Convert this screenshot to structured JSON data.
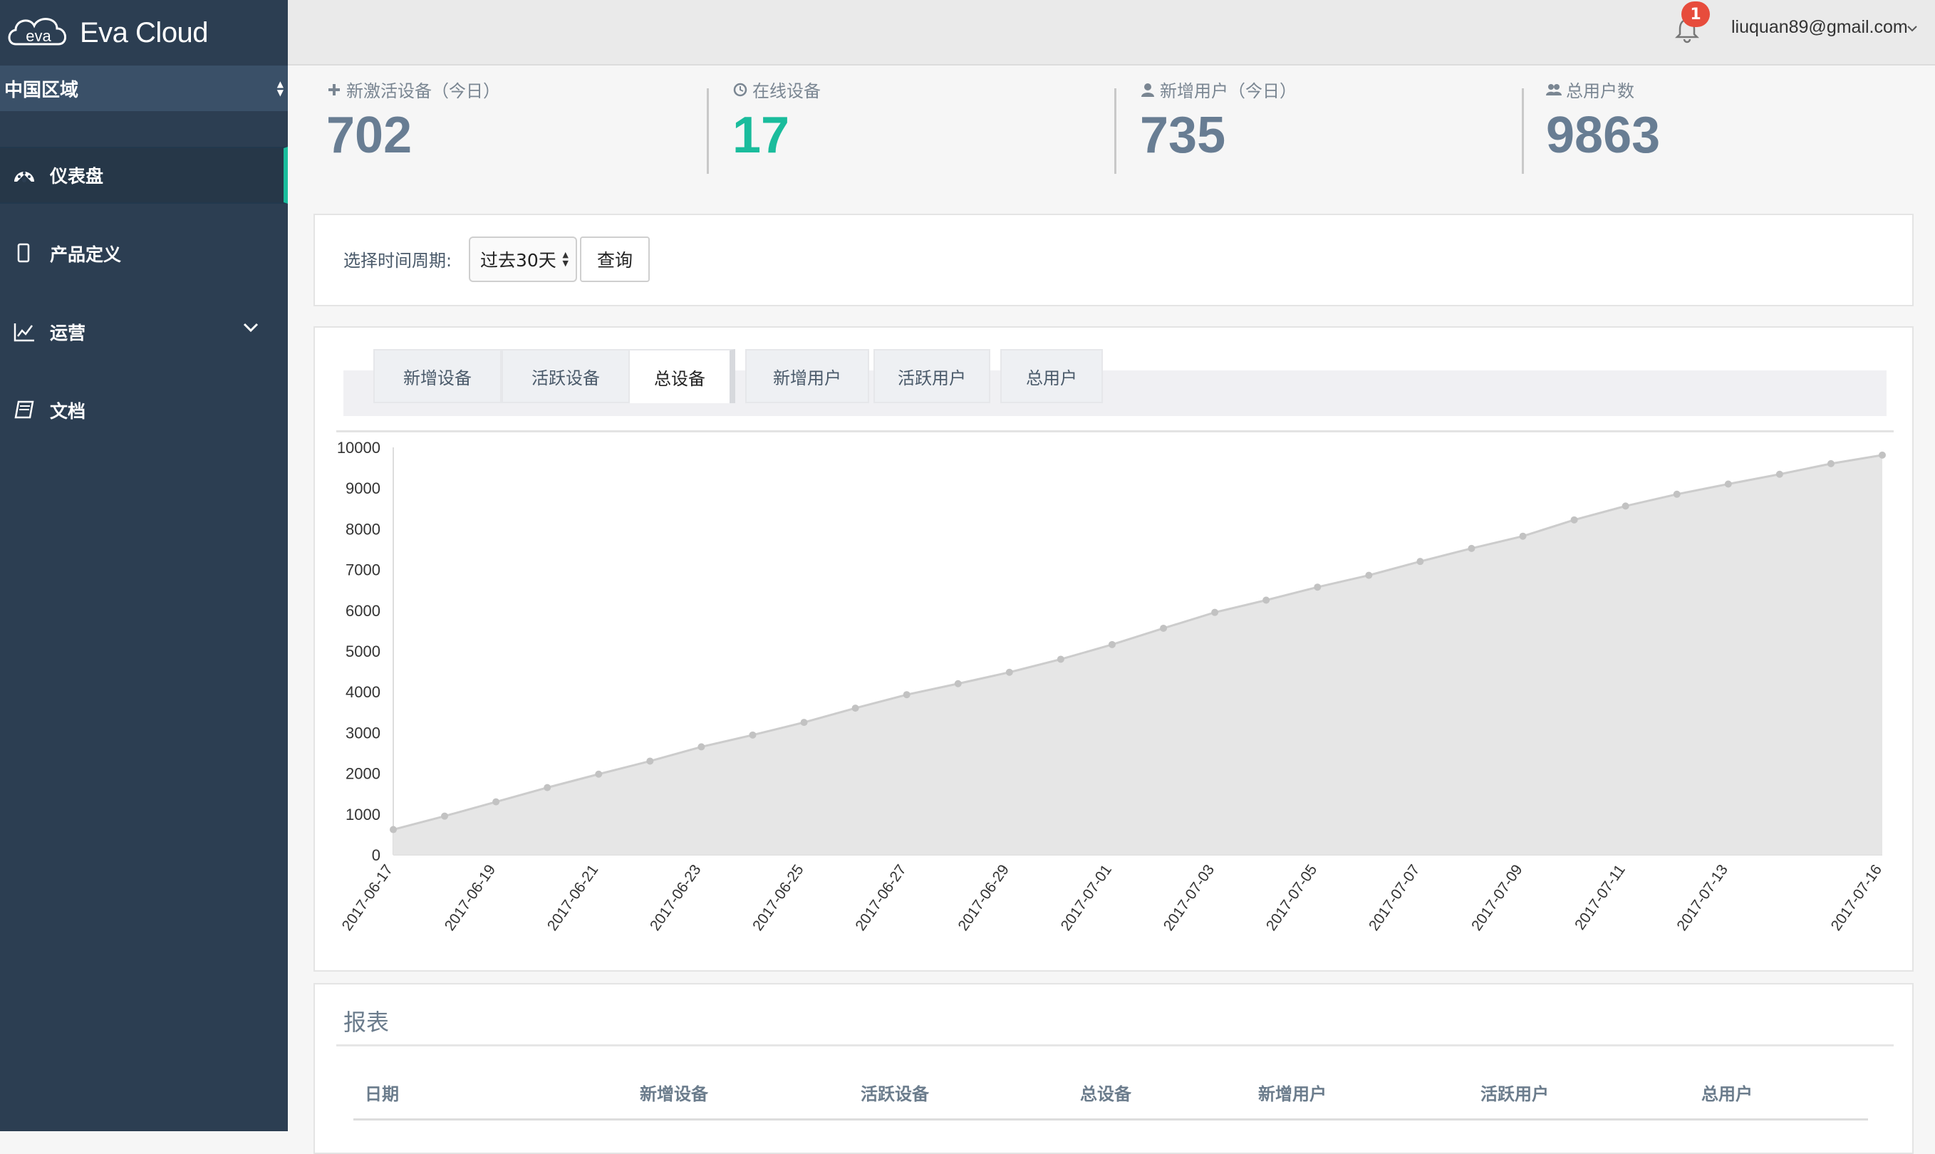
{
  "app": {
    "name": "Eva Cloud"
  },
  "region": {
    "selected": "中国区域"
  },
  "nav": [
    {
      "label": "仪表盘",
      "icon": "dashboard-icon"
    },
    {
      "label": "产品定义",
      "icon": "mobile-icon"
    },
    {
      "label": "运营",
      "icon": "line-chart-icon"
    },
    {
      "label": "文档",
      "icon": "book-icon"
    }
  ],
  "topbar": {
    "notifications": "1",
    "user_email": "liuquan89@gmail.com"
  },
  "stats": [
    {
      "label": "新激活设备（今日）",
      "value": "702",
      "icon": "plus-icon"
    },
    {
      "label": "在线设备",
      "value": "17",
      "icon": "clock-icon"
    },
    {
      "label": "新增用户（今日）",
      "value": "735",
      "icon": "user-icon"
    },
    {
      "label": "总用户数",
      "value": "9863",
      "icon": "users-icon"
    }
  ],
  "filter": {
    "label": "选择时间周期:",
    "period": "过去30天",
    "query_button": "查询"
  },
  "tabs": [
    "新增设备",
    "活跃设备",
    "总设备",
    "新增用户",
    "活跃用户",
    "总用户"
  ],
  "active_tab": "总设备",
  "chart_data": {
    "type": "area",
    "x": [
      "2017-06-17",
      "2017-06-18",
      "2017-06-19",
      "2017-06-20",
      "2017-06-21",
      "2017-06-22",
      "2017-06-23",
      "2017-06-24",
      "2017-06-25",
      "2017-06-26",
      "2017-06-27",
      "2017-06-28",
      "2017-06-29",
      "2017-06-30",
      "2017-07-01",
      "2017-07-02",
      "2017-07-03",
      "2017-07-04",
      "2017-07-05",
      "2017-07-06",
      "2017-07-07",
      "2017-07-08",
      "2017-07-09",
      "2017-07-10",
      "2017-07-11",
      "2017-07-12",
      "2017-07-13",
      "2017-07-14",
      "2017-07-15",
      "2017-07-16"
    ],
    "x_tick_labels": [
      "2017-06-17",
      "2017-06-19",
      "2017-06-21",
      "2017-06-23",
      "2017-06-25",
      "2017-06-27",
      "2017-06-29",
      "2017-07-01",
      "2017-07-03",
      "2017-07-05",
      "2017-07-07",
      "2017-07-09",
      "2017-07-11",
      "2017-07-13",
      "2017-07-16"
    ],
    "series": [
      {
        "values": [
          620,
          950,
          1300,
          1650,
          1980,
          2300,
          2650,
          2940,
          3250,
          3600,
          3930,
          4200,
          4480,
          4800,
          5160,
          5560,
          5950,
          6250,
          6570,
          6860,
          7200,
          7520,
          7820,
          8220,
          8560,
          8850,
          9100,
          9340,
          9600,
          9810
        ]
      }
    ],
    "y_ticks": [
      0,
      1000,
      2000,
      3000,
      4000,
      5000,
      6000,
      7000,
      8000,
      9000,
      10000
    ],
    "ylim": [
      0,
      10000
    ],
    "grid": false,
    "colors": {
      "fill": "#e6e6e6",
      "line": "#cccccc",
      "point": "#c2c2c2"
    }
  },
  "report": {
    "title": "报表",
    "columns": [
      "日期",
      "新增设备",
      "活跃设备",
      "总设备",
      "新增用户",
      "活跃用户",
      "总用户"
    ]
  }
}
